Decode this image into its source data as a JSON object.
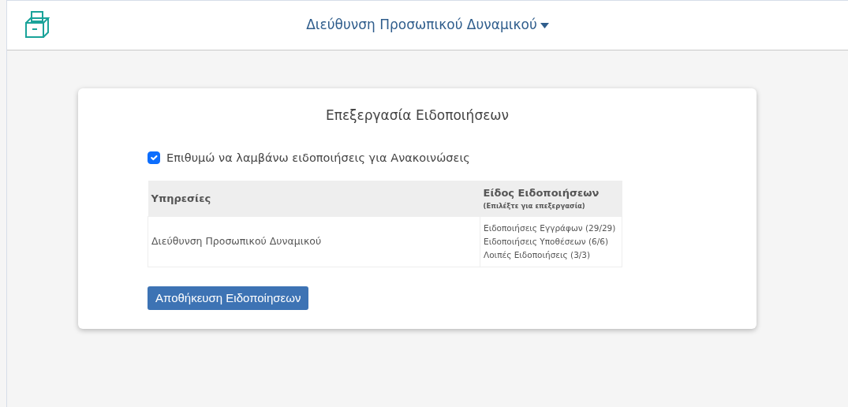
{
  "header": {
    "title": "Διεύθυνση Προσωπικού Δυναμικού"
  },
  "panel": {
    "title": "Επεξεργασία Ειδοποιήσεων",
    "subscribe": {
      "label": "Επιθυμώ να λαμβάνω ειδοποιήσεις για Ανακοινώσεις",
      "checked": true
    },
    "table": {
      "columns": [
        {
          "label": "Υπηρεσίες"
        },
        {
          "label": "Είδος Ειδοποιήσεων",
          "hint": "(Επιλέξτε για επεξεργασία)"
        }
      ],
      "rows": [
        {
          "service": "Διεύθυνση Προσωπικού Δυναμικού",
          "types": [
            "Ειδοποιήσεις Εγγράφων (29/29)",
            "Ειδοποιήσεις Υποθέσεων (6/6)",
            "Λοιπές Ειδοποιήσεις (3/3)"
          ]
        }
      ]
    },
    "button": "Αποθήκευση Ειδοποίησεων"
  }
}
